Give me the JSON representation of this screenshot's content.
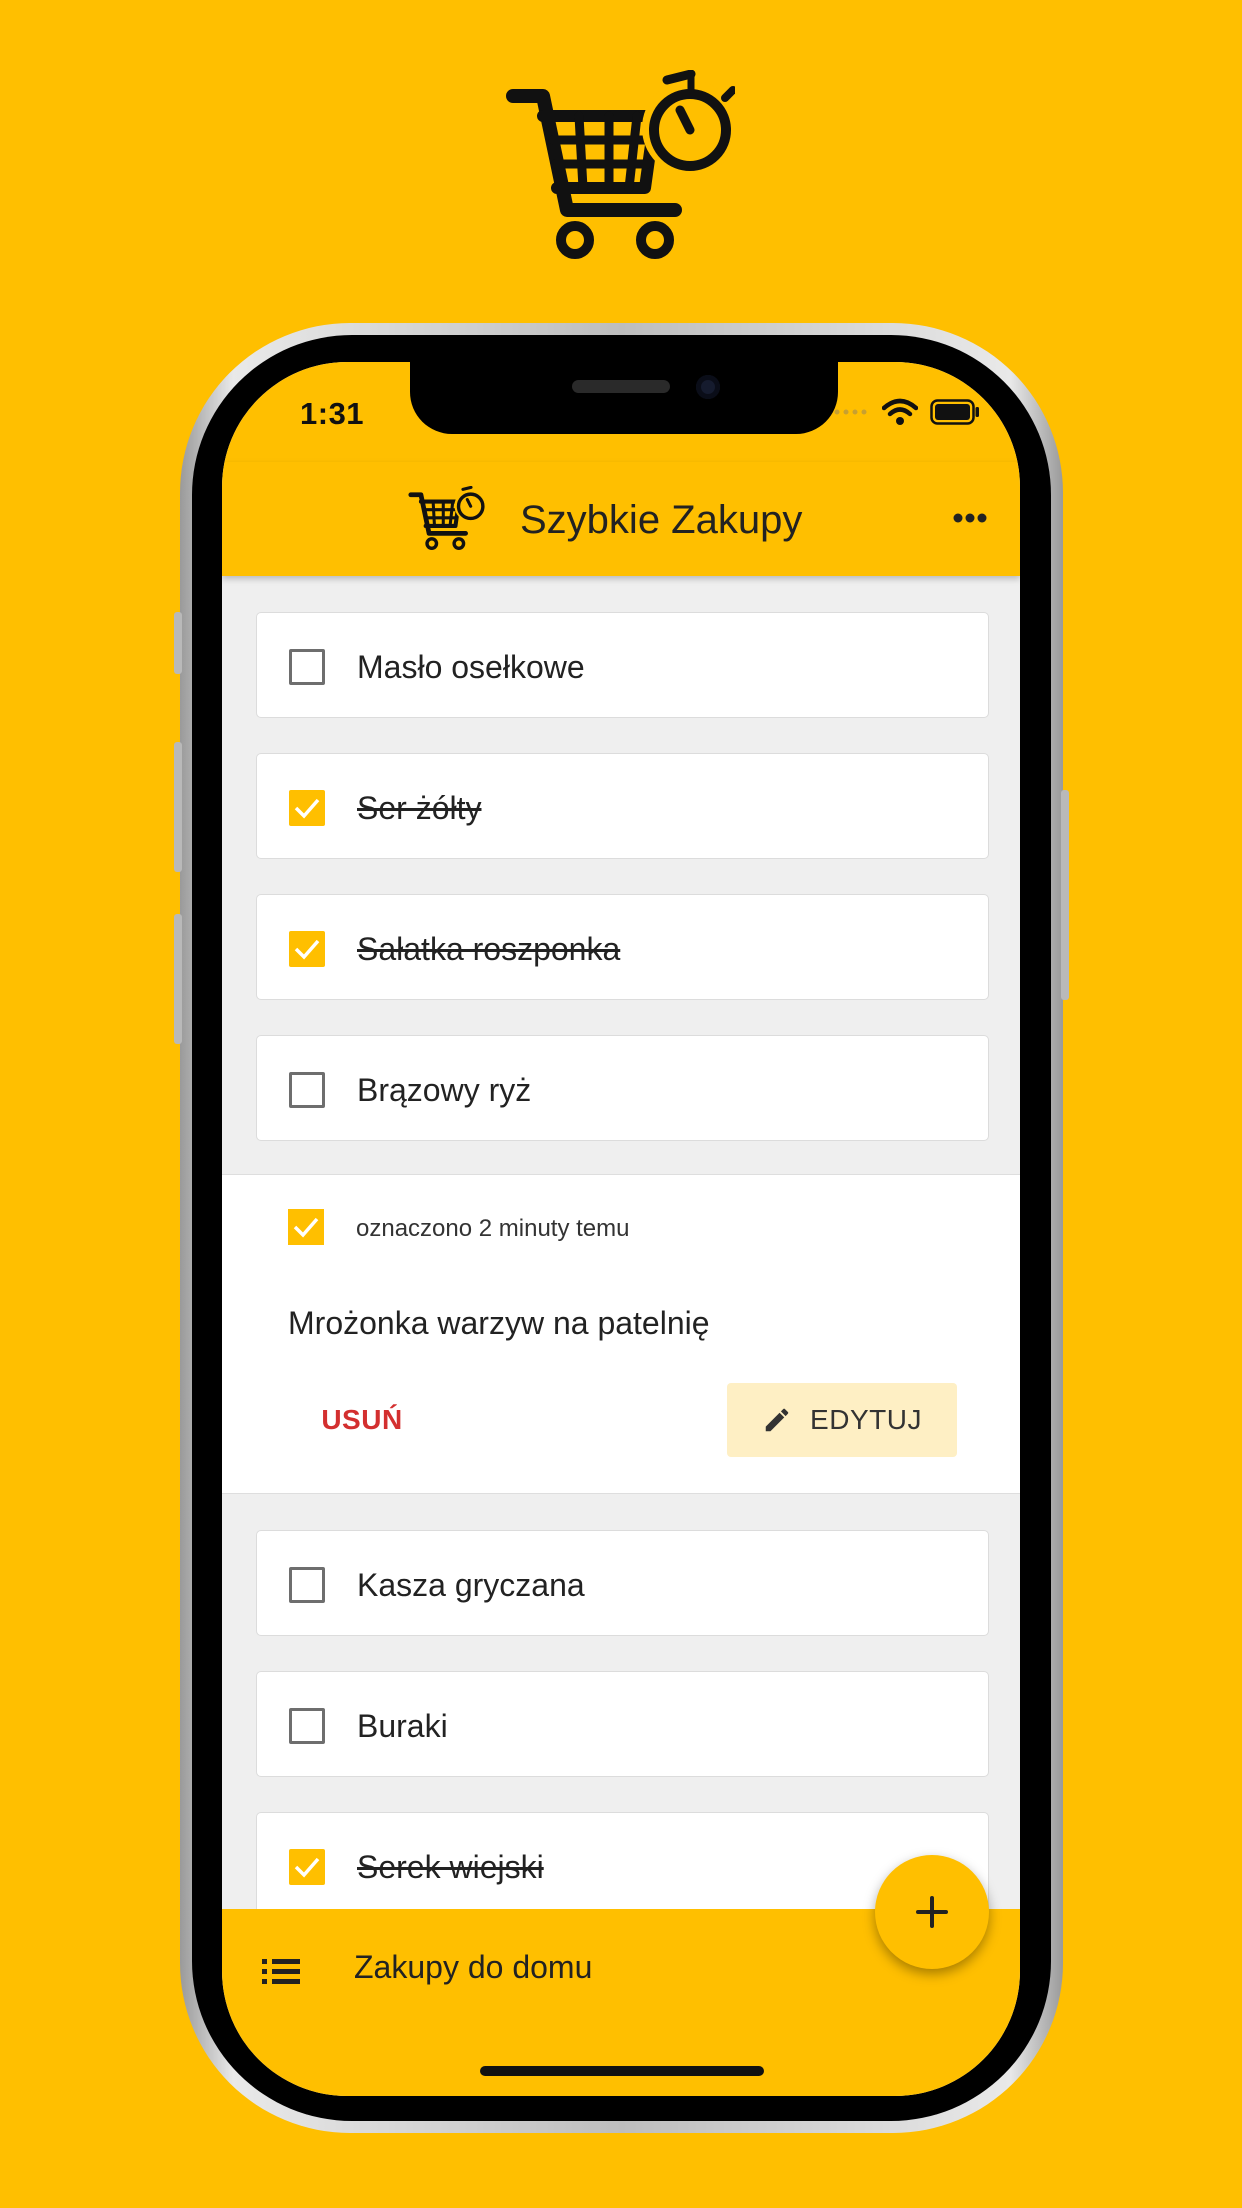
{
  "status_bar": {
    "time": "1:31"
  },
  "app_bar": {
    "title": "Szybkie Zakupy"
  },
  "items": [
    {
      "label": "Masło osełkowe",
      "checked": false
    },
    {
      "label": "Ser żółty",
      "checked": true
    },
    {
      "label": "Sałatka roszponka",
      "checked": true
    },
    {
      "label": "Brązowy ryż",
      "checked": false
    },
    {
      "label": "Kasza gryczana",
      "checked": false
    },
    {
      "label": "Buraki",
      "checked": false
    },
    {
      "label": "Serek wiejski",
      "checked": true
    }
  ],
  "expanded_item": {
    "checked": true,
    "meta": "oznaczono 2 minuty temu",
    "label": "Mrożonka warzyw na patelnię",
    "delete_label": "USUŃ",
    "edit_label": "EDYTUJ"
  },
  "bottom_bar": {
    "list_name": "Zakupy do domu"
  },
  "colors": {
    "accent": "#FFBF00",
    "danger": "#D32F2F",
    "edit_bg": "#FEEFC4"
  },
  "icons": [
    "shopping-cart-timer-icon",
    "wifi-icon",
    "battery-icon",
    "more-horizontal-icon",
    "checkbox-icon",
    "pencil-icon",
    "list-icon",
    "plus-icon"
  ]
}
